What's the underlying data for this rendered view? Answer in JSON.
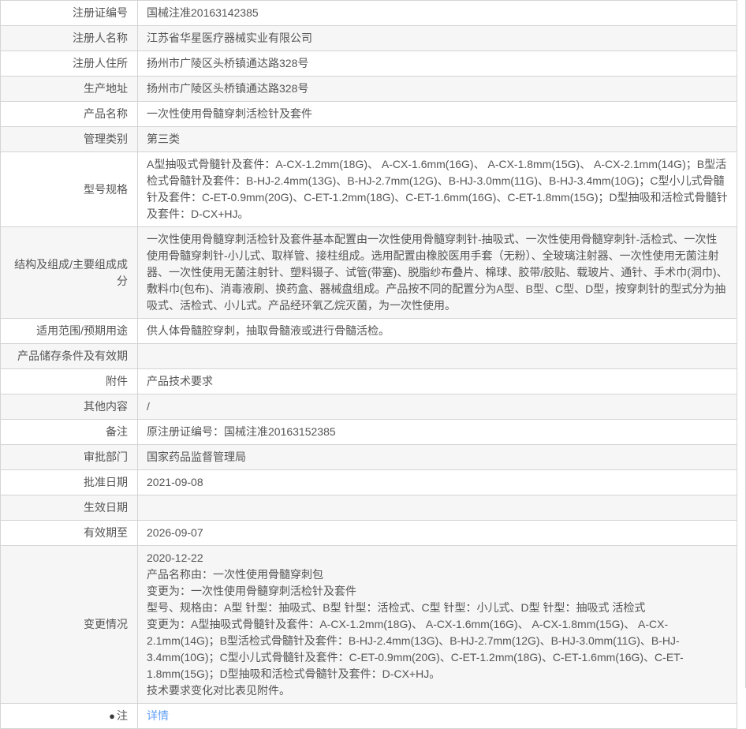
{
  "theme": {
    "border": "#d4d4d4",
    "stripe": "#f6f6f6",
    "text": "#555555",
    "link": "#64a0f5",
    "bg": "#ffffff"
  },
  "table": {
    "rows": [
      {
        "label": "注册证编号",
        "value": "国械注准20163142385"
      },
      {
        "label": "注册人名称",
        "value": "江苏省华星医疗器械实业有限公司"
      },
      {
        "label": "注册人住所",
        "value": "扬州市广陵区头桥镇通达路328号"
      },
      {
        "label": "生产地址",
        "value": "扬州市广陵区头桥镇通达路328号"
      },
      {
        "label": "产品名称",
        "value": "一次性使用骨髓穿刺活检针及套件"
      },
      {
        "label": "管理类别",
        "value": "第三类"
      },
      {
        "label": "型号规格",
        "value": "A型抽吸式骨髓针及套件：A-CX-1.2mm(18G)、 A-CX-1.6mm(16G)、 A-CX-1.8mm(15G)、 A-CX-2.1mm(14G)；B型活检式骨髓针及套件：B-HJ-2.4mm(13G)、B-HJ-2.7mm(12G)、B-HJ-3.0mm(11G)、B-HJ-3.4mm(10G)；C型小儿式骨髓针及套件：C-ET-0.9mm(20G)、C-ET-1.2mm(18G)、C-ET-1.6mm(16G)、C-ET-1.8mm(15G)；D型抽吸和活检式骨髓针及套件：D-CX+HJ。"
      },
      {
        "label": "结构及组成/主要组成成分",
        "value": "一次性使用骨髓穿刺活检针及套件基本配置由一次性使用骨髓穿刺针-抽吸式、一次性使用骨髓穿刺针-活检式、一次性使用骨髓穿刺针-小儿式、取样管、接柱组成。选用配置由橡胶医用手套（无粉）、全玻璃注射器、一次性使用无菌注射器、一次性使用无菌注射针、塑料镊子、试管(带塞)、脱脂纱布叠片、棉球、胶带/胶贴、载玻片、通针、手术巾(洞巾)、敷料巾(包布)、消毒液刷、换药盒、器械盘组成。产品按不同的配置分为A型、B型、C型、D型，按穿刺针的型式分为抽吸式、活检式、小儿式。产品经环氧乙烷灭菌，为一次性使用。"
      },
      {
        "label": "适用范围/预期用途",
        "value": "供人体骨髓腔穿刺，抽取骨髓液或进行骨髓活检。"
      },
      {
        "label": "产品储存条件及有效期",
        "value": ""
      },
      {
        "label": "附件",
        "value": "产品技术要求"
      },
      {
        "label": "其他内容",
        "value": "/"
      },
      {
        "label": "备注",
        "value": "原注册证编号：国械注准20163152385"
      },
      {
        "label": "审批部门",
        "value": "国家药品监督管理局"
      },
      {
        "label": "批准日期",
        "value": "2021-09-08"
      },
      {
        "label": "生效日期",
        "value": ""
      },
      {
        "label": "有效期至",
        "value": "2026-09-07"
      },
      {
        "label": "变更情况",
        "value": "2020-12-22\n产品名称由：一次性使用骨髓穿刺包\n变更为：一次性使用骨髓穿刺活检针及套件\n型号、规格由：A型 针型：抽吸式、B型 针型：活检式、C型 针型：小儿式、D型 针型：抽吸式 活检式\n变更为：A型抽吸式骨髓针及套件：A-CX-1.2mm(18G)、 A-CX-1.6mm(16G)、 A-CX-1.8mm(15G)、 A-CX-2.1mm(14G)；B型活检式骨髓针及套件：B-HJ-2.4mm(13G)、B-HJ-2.7mm(12G)、B-HJ-3.0mm(11G)、B-HJ-3.4mm(10G)；C型小儿式骨髓针及套件：C-ET-0.9mm(20G)、C-ET-1.2mm(18G)、C-ET-1.6mm(16G)、C-ET-1.8mm(15G)；D型抽吸和活检式骨髓针及套件：D-CX+HJ。\n技术要求变化对比表见附件。"
      },
      {
        "label": "注",
        "icon": {
          "name": "note-bubble-icon",
          "glyph": "●"
        },
        "link": "详情"
      }
    ]
  }
}
